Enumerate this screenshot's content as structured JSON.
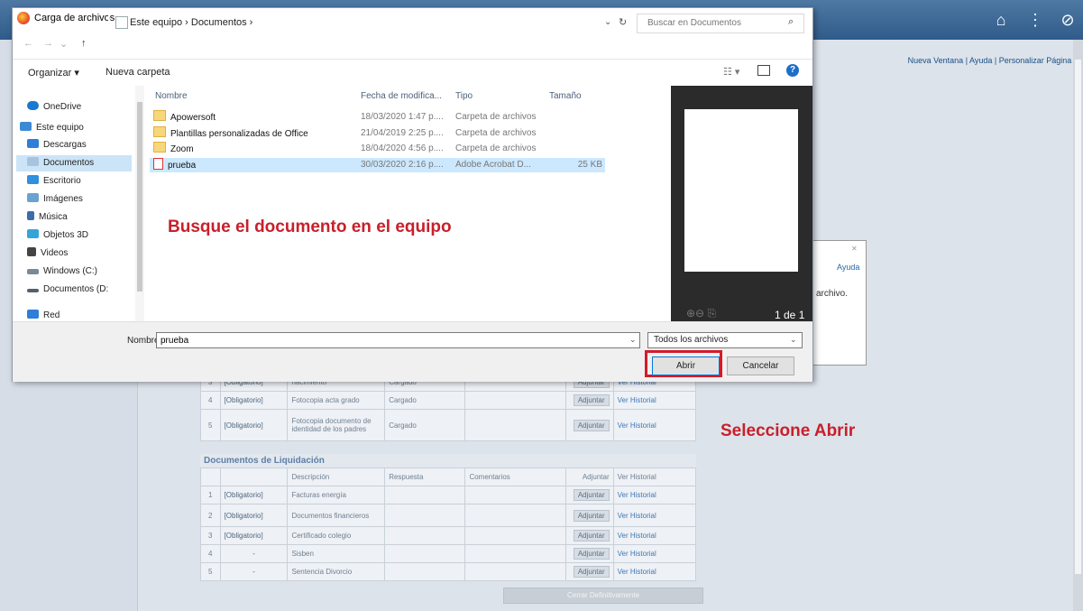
{
  "dialog": {
    "title": "Carga de archivos",
    "address": "Este equipo  ›  Documentos  ›",
    "search_placeholder": "Buscar en Documentos",
    "toolbar": {
      "organize": "Organizar ▾",
      "new_folder": "Nueva carpeta"
    },
    "nav_items": [
      {
        "label": "OneDrive",
        "icon": "cloud-icon",
        "color": "#1b78d0"
      },
      {
        "label": "Este equipo",
        "icon": "computer-icon",
        "color": "#3c8ad6"
      },
      {
        "label": "Descargas",
        "icon": "download-icon",
        "color": "#2f7ed8"
      },
      {
        "label": "Documentos",
        "icon": "documents-icon",
        "color": "#a8c3dd",
        "selected": true
      },
      {
        "label": "Escritorio",
        "icon": "desktop-icon",
        "color": "#2f8fe0"
      },
      {
        "label": "Imágenes",
        "icon": "pictures-icon",
        "color": "#6aa2d2"
      },
      {
        "label": "Música",
        "icon": "music-icon",
        "color": "#3a6ea8"
      },
      {
        "label": "Objetos 3D",
        "icon": "objects3d-icon",
        "color": "#35a4d9"
      },
      {
        "label": "Videos",
        "icon": "videos-icon",
        "color": "#444"
      },
      {
        "label": "Windows (C:)",
        "icon": "drive-icon",
        "color": "#7b8896"
      },
      {
        "label": "Documentos (D:",
        "icon": "drive-icon",
        "color": "#55606b"
      },
      {
        "label": "Red",
        "icon": "network-icon",
        "color": "#2f7ed8"
      }
    ],
    "columns": {
      "name": "Nombre",
      "date": "Fecha de modifica...",
      "type": "Tipo",
      "size": "Tamaño"
    },
    "files": [
      {
        "name": "Apowersoft",
        "date": "18/03/2020 1:47 p....",
        "type": "Carpeta de archivos",
        "size": "",
        "kind": "folder"
      },
      {
        "name": "Plantillas personalizadas de Office",
        "date": "21/04/2019 2:25 p....",
        "type": "Carpeta de archivos",
        "size": "",
        "kind": "folder"
      },
      {
        "name": "Zoom",
        "date": "18/04/2020 4:56 p....",
        "type": "Carpeta de archivos",
        "size": "",
        "kind": "folder"
      },
      {
        "name": "prueba",
        "date": "30/03/2020 2:16 p....",
        "type": "Adobe Acrobat D...",
        "size": "25 KB",
        "kind": "pdf",
        "selected": true
      }
    ],
    "preview_page": "1 de 1",
    "filename_label": "Nombre:",
    "filename_value": "prueba",
    "filter": "Todos los archivos",
    "open_button": "Abrir",
    "cancel_button": "Cancelar"
  },
  "annotations": {
    "find": "Busque el documento en el equipo",
    "open": "Seleccione Abrir",
    "color": "#c8202b"
  },
  "background": {
    "links": "Nueva Ventana | Ayuda | Personalizar Página ^",
    "side_dialog": {
      "help": "Ayuda",
      "text": "archivo."
    },
    "partial_row": {
      "num": "3",
      "req": "[Obligatorio]",
      "desc": "nacimiento",
      "resp": "Cargado",
      "btn": "Adjuntar",
      "hist": "Ver Historial"
    },
    "upper_rows": [
      {
        "num": "4",
        "req": "[Obligatorio]",
        "desc": "Fotocopia acta grado",
        "resp": "Cargado",
        "btn": "Adjuntar",
        "hist": "Ver Historial"
      },
      {
        "num": "5",
        "req": "[Obligatorio]",
        "desc": "Fotocopia documento de identidad de los padres",
        "resp": "Cargado",
        "btn": "Adjuntar",
        "hist": "Ver Historial"
      }
    ],
    "liq_title": "Documentos de Liquidación",
    "liq_headers": [
      "",
      "",
      "Descripción",
      "Respuesta",
      "Comentarios",
      "Adjuntar",
      "Ver Historial"
    ],
    "liq_rows": [
      {
        "num": "1",
        "req": "[Obligatorio]",
        "desc": "Facturas energía",
        "btn": "Adjuntar",
        "hist": "Ver Historial"
      },
      {
        "num": "2",
        "req": "[Obligatorio]",
        "desc": "Documentos financieros",
        "btn": "Adjuntar",
        "hist": "Ver Historial"
      },
      {
        "num": "3",
        "req": "[Obligatorio]",
        "desc": "Certificado colegio",
        "btn": "Adjuntar",
        "hist": "Ver Historial"
      },
      {
        "num": "4",
        "req": "-",
        "desc": "Sisben",
        "btn": "Adjuntar",
        "hist": "Ver Historial"
      },
      {
        "num": "5",
        "req": "-",
        "desc": "Sentencia Divorcio",
        "btn": "Adjuntar",
        "hist": "Ver Historial"
      }
    ],
    "close_button": "Cerrar Definitivamente"
  }
}
